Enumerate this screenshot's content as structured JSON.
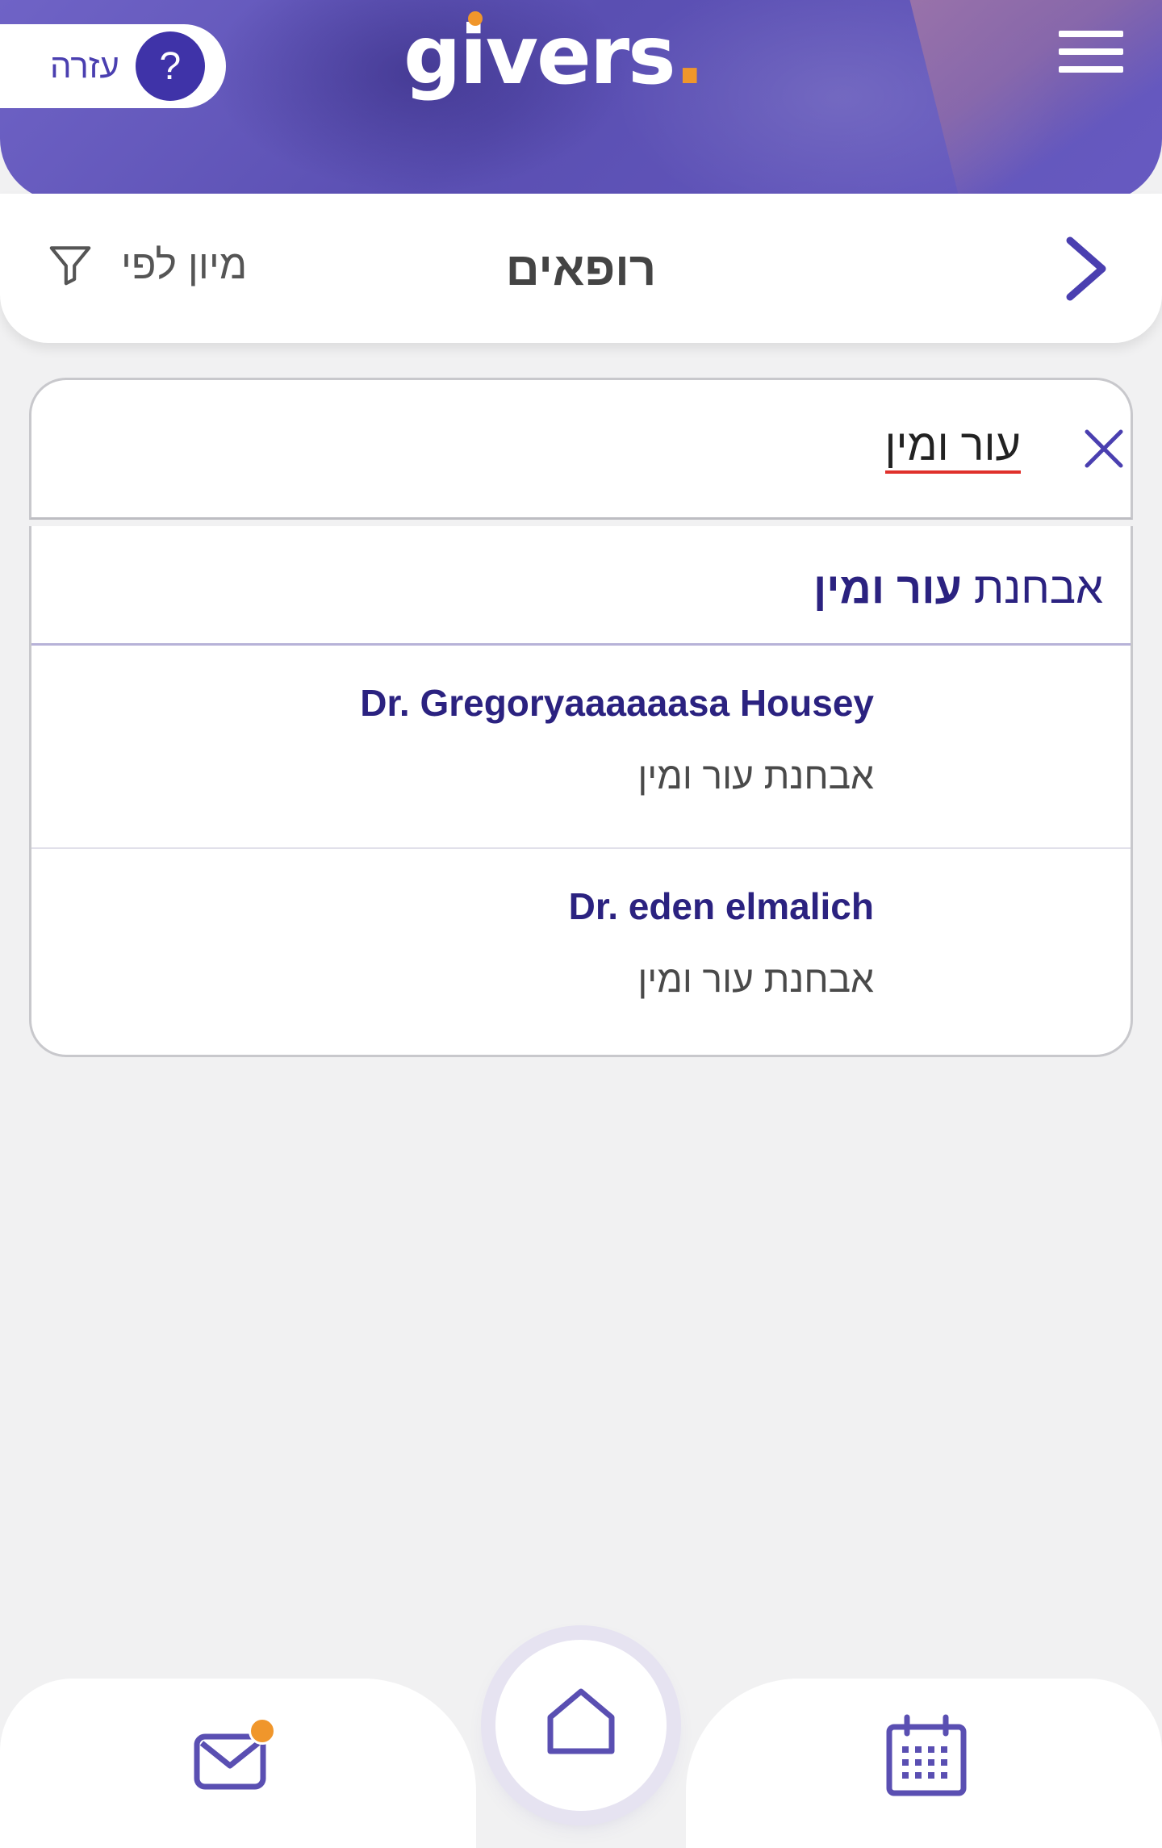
{
  "header": {
    "logo_text": "givers",
    "help_label": "עזרה",
    "help_icon": "question-icon",
    "menu_icon": "hamburger-icon"
  },
  "title_bar": {
    "title": "רופאים",
    "sort_label": "מיון לפי",
    "sort_icon": "filter-icon",
    "back_icon": "chevron-right-icon"
  },
  "search": {
    "query": "עור ומין",
    "clear_icon": "close-icon"
  },
  "results": {
    "category": {
      "prefix": "אבחנת",
      "highlight": "עור ומין"
    },
    "doctors": [
      {
        "name": "Dr. Gregoryaaaaaasa Housey",
        "specialty": "אבחנת עור ומין"
      },
      {
        "name": "Dr. eden elmalich",
        "specialty": "אבחנת עור ומין"
      }
    ]
  },
  "bottom_nav": {
    "items": [
      {
        "icon": "mail-icon",
        "has_badge": true
      },
      {
        "icon": "home-icon"
      },
      {
        "icon": "calendar-icon"
      }
    ]
  },
  "colors": {
    "brand_purple": "#5a4fb2",
    "dark_purple": "#2b2280",
    "accent_orange": "#f0962b"
  }
}
